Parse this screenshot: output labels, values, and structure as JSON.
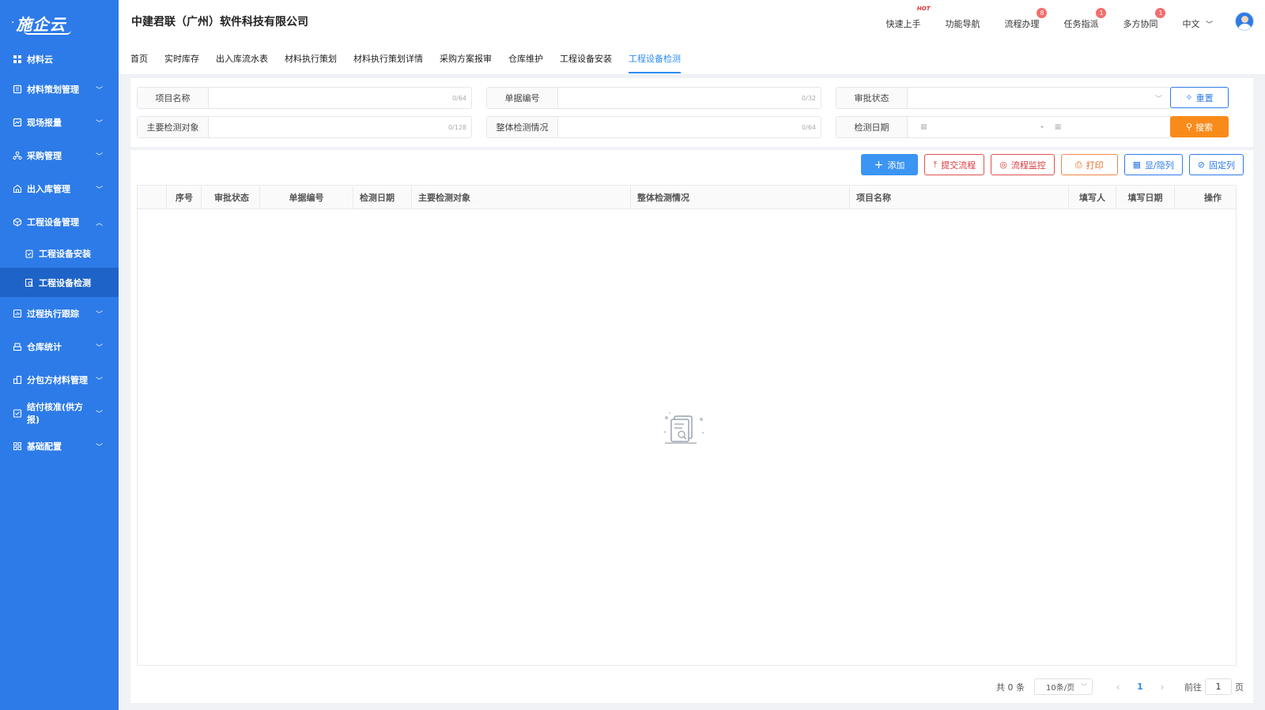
{
  "sidebar": {
    "logo": "施企云",
    "home": "材料云",
    "items": [
      {
        "label": "材料策划管理",
        "icon": "notebook-icon"
      },
      {
        "label": "现场报量",
        "icon": "report-icon"
      },
      {
        "label": "采购管理",
        "icon": "org-icon"
      },
      {
        "label": "出入库管理",
        "icon": "warehouse-icon"
      },
      {
        "label": "工程设备管理",
        "icon": "cube-icon"
      }
    ],
    "subitems": [
      {
        "label": "工程设备安装"
      },
      {
        "label": "工程设备检测"
      }
    ],
    "items2": [
      {
        "label": "过程执行跟踪"
      },
      {
        "label": "仓库统计"
      },
      {
        "label": "分包方材料管理"
      },
      {
        "label": "结付核准(供方报)"
      },
      {
        "label": "基础配置"
      }
    ]
  },
  "header": {
    "company": "中建君联（广州）软件科技有限公司",
    "links": [
      {
        "label": "快速上手",
        "hot": "HOT"
      },
      {
        "label": "功能导航"
      },
      {
        "label": "流程办理",
        "badge": "8"
      },
      {
        "label": "任务指派",
        "badge": "1"
      },
      {
        "label": "多方协同",
        "badge": "1"
      }
    ],
    "language": "中文"
  },
  "tabs": [
    "首页",
    "实时库存",
    "出入库流水表",
    "材料执行策划",
    "材料执行策划详情",
    "采购方案报审",
    "仓库维护",
    "工程设备安装",
    "工程设备检测"
  ],
  "filters": {
    "project_name": {
      "label": "项目名称",
      "count": "0/64"
    },
    "doc_no": {
      "label": "单据编号",
      "count": "0/32"
    },
    "approval_status": {
      "label": "审批状态"
    },
    "main_object": {
      "label": "主要检测对象",
      "count": "0/128"
    },
    "overall": {
      "label": "整体检测情况",
      "count": "0/64"
    },
    "test_date": {
      "label": "检测日期",
      "separator": "-"
    },
    "reset": "重置",
    "search": "搜索"
  },
  "toolbar": {
    "add": "添加",
    "submit": "提交流程",
    "monitor": "流程监控",
    "print": "打印",
    "toggle_cols": "显/隐列",
    "fix_cols": "固定列"
  },
  "table": {
    "columns": [
      "序号",
      "审批状态",
      "单据编号",
      "检测日期",
      "主要检测对象",
      "整体检测情况",
      "项目名称",
      "填写人",
      "填写日期",
      "操作"
    ]
  },
  "pager": {
    "total": "共 0 条",
    "page_size": "10条/页",
    "current": "1",
    "goto": "前往",
    "goto_value": "1",
    "page_unit": "页"
  },
  "colors": {
    "sidebar": "#2d7be8",
    "active_tab": "#2d8cf0",
    "search_button": "#f98b1b",
    "danger": "#d93b3b"
  }
}
